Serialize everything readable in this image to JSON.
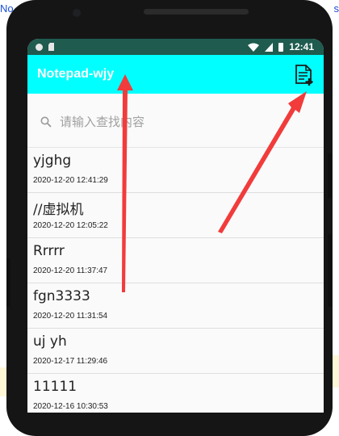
{
  "host": {
    "left_text": "No",
    "right_text": "s"
  },
  "status_bar": {
    "time": "12:41"
  },
  "app_bar": {
    "title": "Notepad-wjy"
  },
  "search": {
    "placeholder": "请输入查找内容"
  },
  "notes": [
    {
      "title": "yjghg",
      "date": "2020-12-20 12:41:29"
    },
    {
      "title": "//虚拟机",
      "date": "2020-12-20 12:05:22"
    },
    {
      "title": "Rrrrr",
      "date": "2020-12-20 11:37:47"
    },
    {
      "title": "fgn3333",
      "date": "2020-12-20 11:31:54"
    },
    {
      "title": "uj yh",
      "date": "2020-12-17 11:29:46"
    },
    {
      "title": "11111",
      "date": "2020-12-16 10:30:53"
    }
  ],
  "colors": {
    "app_bar": "#00ffff",
    "status_bar": "#1f5b4f",
    "annotation_arrow": "#f23b3b"
  },
  "icons": [
    "add-note-icon",
    "search-icon",
    "wifi-icon",
    "signal-icon",
    "battery-icon"
  ]
}
